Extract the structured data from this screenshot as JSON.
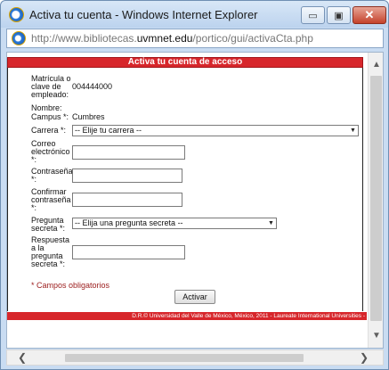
{
  "window": {
    "title": "Activa tu cuenta - Windows Internet Explorer",
    "min_glyph": "▭",
    "max_glyph": "▣",
    "close_glyph": "✕"
  },
  "address": {
    "prefix": "http://www.bibliotecas.",
    "domain": "uvmnet.edu",
    "path": "/portico/gui/activaCta.php"
  },
  "form": {
    "header": "Activa tu cuenta de acceso",
    "matricula_label": "Matrícula o clave de empleado:",
    "matricula_value": "004444000",
    "nombre_label": "Nombre:",
    "nombre_value": "",
    "campus_label": "Campus *:",
    "campus_value": "Cumbres",
    "carrera_label": "Carrera *:",
    "carrera_selected": "-- Elije tu carrera --",
    "correo_label": "Correo electrónico *:",
    "correo_value": "",
    "contrasena_label": "Contraseña *:",
    "contrasena_value": "",
    "confirmar_label": "Confirmar contraseña *:",
    "confirmar_value": "",
    "pregunta_label": "Pregunta secreta *:",
    "pregunta_selected": "-- Elija una pregunta secreta --",
    "respuesta_label": "Respuesta a la pregunta secreta *:",
    "respuesta_value": "",
    "required_note": "* Campos obligatorios",
    "submit_label": "Activar"
  },
  "footer": {
    "text": "D.R.© Universidad del Valle de México, México, 2011 - Laureate International Universities - "
  },
  "colors": {
    "brand_red": "#d7262b",
    "required_note": "#9b1b1b"
  },
  "scrollbars": {
    "up_glyph": "▲",
    "down_glyph": "▼",
    "left_glyph": "❮",
    "right_glyph": "❯"
  }
}
